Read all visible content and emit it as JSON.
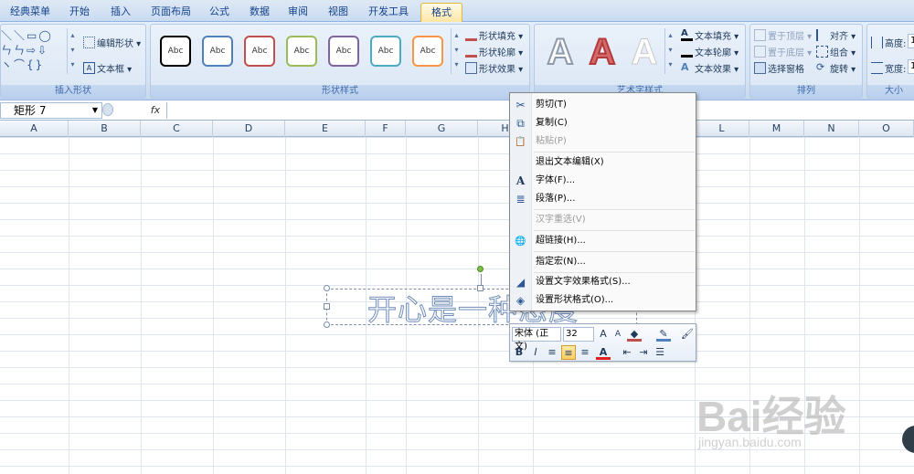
{
  "tabs": [
    "经典菜单",
    "开始",
    "插入",
    "页面布局",
    "公式",
    "数据",
    "审阅",
    "视图",
    "开发工具",
    "格式"
  ],
  "active_tab": "格式",
  "ribbon": {
    "insert_shapes": {
      "label": "插入形状",
      "edit_shape": "编辑形状 ▾",
      "textbox": "文本框 ▾"
    },
    "shape_styles": {
      "label": "形状样式",
      "sample": "Abc",
      "fill": "形状填充 ▾",
      "outline": "形状轮廓 ▾",
      "effects": "形状效果 ▾",
      "swatch_colors": [
        "#000000",
        "#4f81bd",
        "#c0504d",
        "#9bbb59",
        "#8064a2",
        "#4bacc6",
        "#f79646"
      ]
    },
    "wordart": {
      "label": "艺术字样式",
      "letter": "A",
      "text_fill": "文本填充 ▾",
      "text_outline": "文本轮廓 ▾",
      "text_effects": "文本效果 ▾"
    },
    "arrange": {
      "label": "排列",
      "bring_front": "置于顶层 ▾",
      "send_back": "置于底层 ▾",
      "selection_pane": "选择窗格",
      "align": "对齐 ▾",
      "group": "组合 ▾",
      "rotate": "旋转 ▾"
    },
    "size": {
      "label": "大小",
      "height": "高度:",
      "width": "宽度:",
      "height_val": "1",
      "width_val": "1"
    }
  },
  "formula_bar": {
    "name_box": "矩形 7",
    "fx": "fx"
  },
  "columns": [
    "A",
    "B",
    "C",
    "D",
    "E",
    "F",
    "G",
    "H",
    "L",
    "M",
    "N",
    "O"
  ],
  "shape": {
    "text": "开心是一种态度"
  },
  "context_menu": [
    {
      "label": "剪切(T)",
      "icon": "✂",
      "disabled": false
    },
    {
      "label": "复制(C)",
      "icon": "⧉",
      "disabled": false
    },
    {
      "label": "粘贴(P)",
      "icon": "📋",
      "disabled": true
    },
    {
      "label": "退出文本编辑(X)",
      "icon": "",
      "disabled": false
    },
    {
      "label": "字体(F)...",
      "icon": "A",
      "disabled": false
    },
    {
      "label": "段落(P)...",
      "icon": "≣",
      "disabled": false
    },
    {
      "label": "汉字重选(V)",
      "icon": "",
      "disabled": true
    },
    {
      "label": "超链接(H)...",
      "icon": "🌐",
      "disabled": false
    },
    {
      "label": "指定宏(N)...",
      "icon": "",
      "disabled": false
    },
    {
      "label": "设置文字效果格式(S)...",
      "icon": "◢",
      "disabled": false
    },
    {
      "label": "设置形状格式(O)...",
      "icon": "◈",
      "disabled": false
    }
  ],
  "mini_toolbar": {
    "font": "宋体 (正文)",
    "size": "32"
  },
  "watermark": {
    "brand": "Bai经验",
    "url": "jingyan.baidu.com"
  }
}
